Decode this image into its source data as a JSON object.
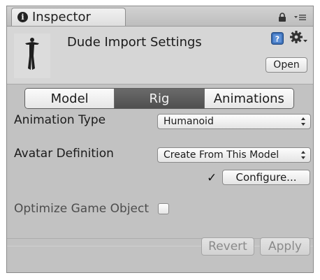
{
  "tab": {
    "icon": "info-icon",
    "icon_glyph": "i",
    "label": "Inspector"
  },
  "tab_controls": {
    "lock": "lock-icon",
    "menu": "tab-menu-icon"
  },
  "header": {
    "title": "Dude Import Settings",
    "preview": "humanoid-model-thumbnail",
    "open_label": "Open",
    "help": "help-icon",
    "settings": "gear-icon"
  },
  "tabs": [
    {
      "label": "Model",
      "active": false
    },
    {
      "label": "Rig",
      "active": true
    },
    {
      "label": "Animations",
      "active": false
    }
  ],
  "rig": {
    "animation_type_label": "Animation Type",
    "animation_type_value": "Humanoid",
    "avatar_definition_label": "Avatar Definition",
    "avatar_definition_value": "Create From This Model",
    "configured_mark": "✓",
    "configure_label": "Configure...",
    "optimize_label": "Optimize Game Object",
    "optimize_checked": false
  },
  "footer": {
    "revert_label": "Revert",
    "apply_label": "Apply",
    "enabled": false
  },
  "colors": {
    "panel_bg": "#c2c2c2",
    "header_bg": "#d6d6d6",
    "active_tab": "#5b5b5b",
    "disabled_text": "#8a8a8a"
  }
}
